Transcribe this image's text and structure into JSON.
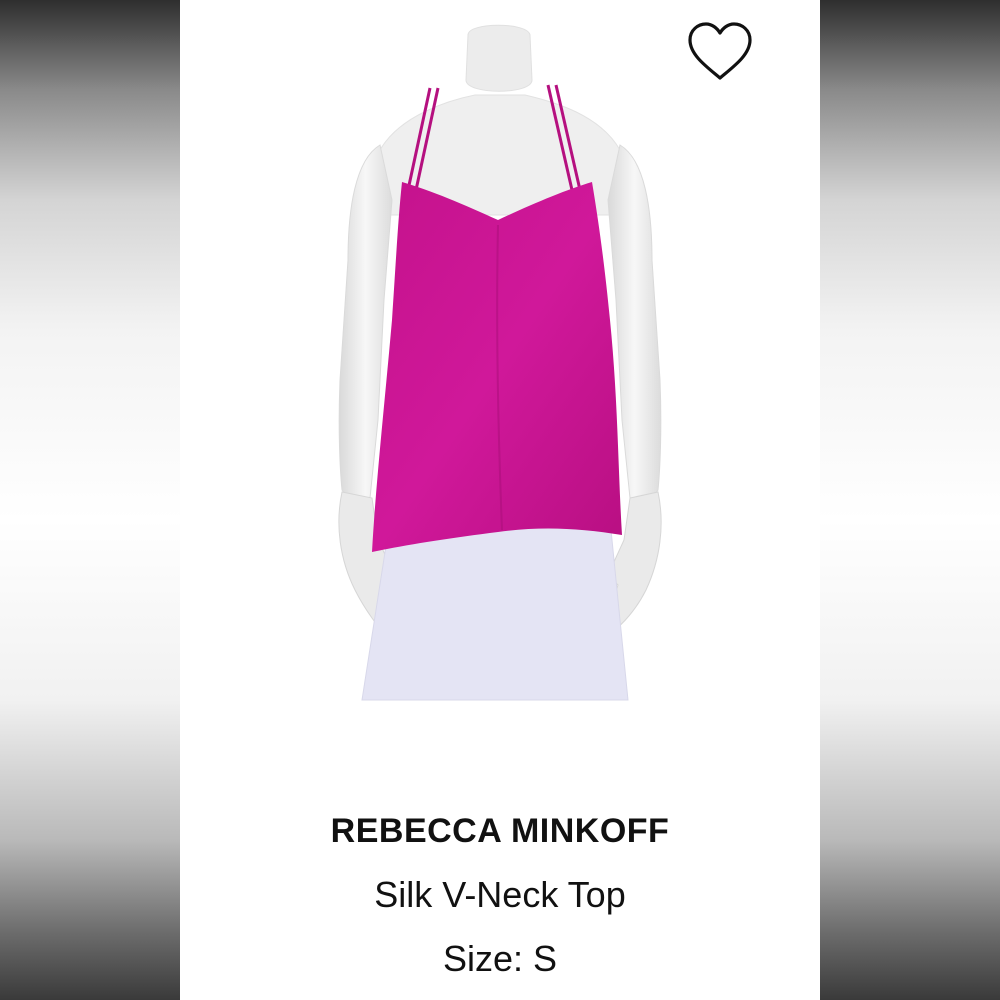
{
  "listing": {
    "brand": "REBECCA MINKOFF",
    "product_name": "Silk V-Neck Top",
    "size": "Size: S"
  },
  "icons": {
    "favorite": "heart-outline-icon"
  },
  "colors": {
    "garment": "#cc1493",
    "skirt": "#e4e4f4",
    "mannequin": "#eeeeee",
    "card_background": "#ffffff"
  }
}
